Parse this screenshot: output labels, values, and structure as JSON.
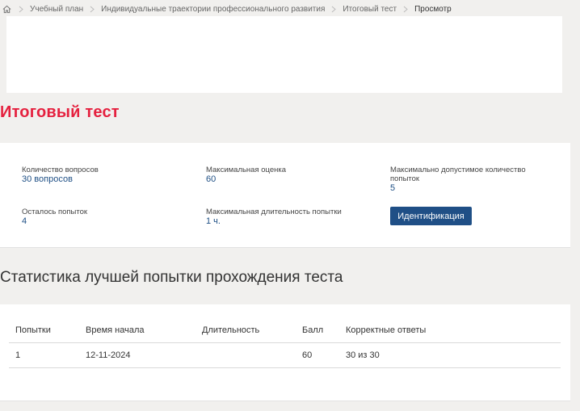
{
  "breadcrumb": {
    "home_icon": "home-icon",
    "items": [
      {
        "label": "Учебный план"
      },
      {
        "label": "Индивидуальные траектории профессионального развития"
      },
      {
        "label": "Итоговый тест"
      },
      {
        "label": "Просмотр"
      }
    ]
  },
  "page": {
    "title": "Итоговый тест"
  },
  "info": {
    "questions_label": "Количество вопросов",
    "questions_value": "30 вопросов",
    "max_score_label": "Максимальная оценка",
    "max_score_value": "60",
    "max_attempts_label": "Максимально допустимое количество попыток",
    "max_attempts_value": "5",
    "remaining_label": "Осталось попыток",
    "remaining_value": "4",
    "max_duration_label": "Максимальная длительность попытки",
    "max_duration_value": "1 ч.",
    "identify_button": "Идентификация"
  },
  "stats": {
    "title": "Статистика лучшей попытки прохождения теста",
    "columns": [
      "Попытки",
      "Время начала",
      "Длительность",
      "Балл",
      "Корректные ответы"
    ],
    "rows": [
      [
        "1",
        "12-11-2024",
        "",
        "60",
        "30 из 30"
      ]
    ]
  },
  "colors": {
    "accent": "#e5213f",
    "link": "#1d4e84",
    "button": "#1f4f86",
    "background": "#f1f0ee"
  }
}
